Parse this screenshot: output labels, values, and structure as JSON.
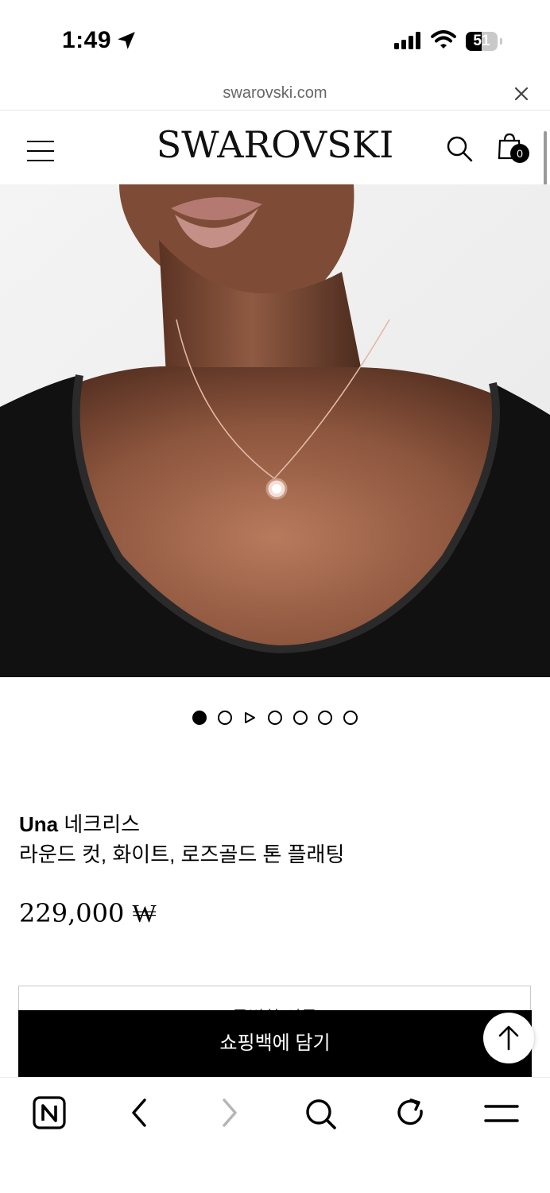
{
  "status_bar": {
    "time": "1:49",
    "battery": "51",
    "battery_level": 0.51
  },
  "browser": {
    "url": "swarovski.com"
  },
  "site": {
    "logo": "SWAROVSKI",
    "cart_count": "0"
  },
  "product": {
    "brand": "Una",
    "name_suffix": " 네크리스",
    "description": "라운드 컷, 화이트, 로즈골드 톤 플래팅",
    "price": "229,000 ₩"
  },
  "carousel": {
    "active_index": 0
  },
  "actions": {
    "special_label": "특별한 선물",
    "add_to_bag": "쇼핑백에 담기"
  },
  "colors": {
    "primary": "#000000",
    "background": "#ffffff"
  },
  "icons": [
    "location-arrow-icon",
    "signal-icon",
    "wifi-icon",
    "battery-icon",
    "close-icon",
    "menu-icon",
    "search-icon",
    "shopping-bag-icon",
    "play-icon",
    "arrow-up-icon",
    "naver-icon",
    "back-icon",
    "forward-icon",
    "search-icon",
    "refresh-icon",
    "menu-icon"
  ]
}
